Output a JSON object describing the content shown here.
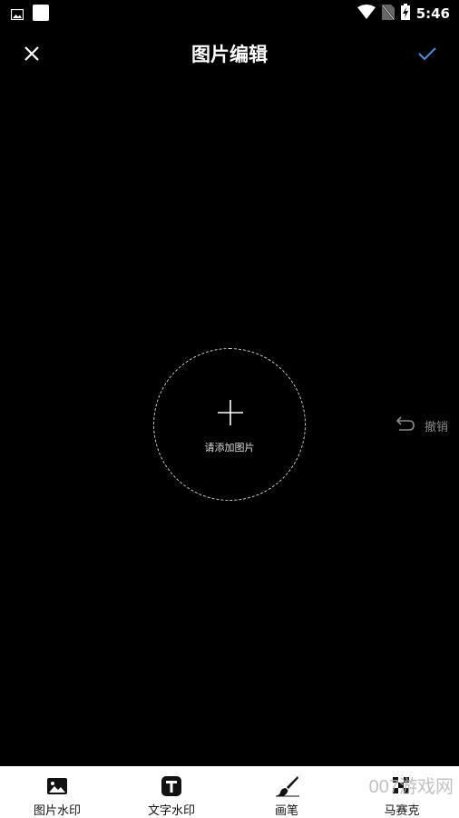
{
  "status_bar": {
    "time": "5:46",
    "icons": [
      "gallery-notification-icon",
      "app-notification-icon",
      "wifi-icon",
      "no-sim-icon",
      "battery-charging-icon"
    ]
  },
  "header": {
    "title": "图片编辑",
    "close_icon": "close-icon",
    "confirm_icon": "check-icon",
    "accent_color": "#4a90e2"
  },
  "canvas": {
    "add_image_label": "请添加图片",
    "undo_label": "撤销"
  },
  "toolbar": {
    "items": [
      {
        "label": "图片水印",
        "icon": "image-icon"
      },
      {
        "label": "文字水印",
        "icon": "text-t-icon"
      },
      {
        "label": "画笔",
        "icon": "brush-icon"
      },
      {
        "label": "马赛克",
        "icon": "mosaic-icon"
      }
    ]
  },
  "watermark": {
    "text": "007游戏网"
  }
}
